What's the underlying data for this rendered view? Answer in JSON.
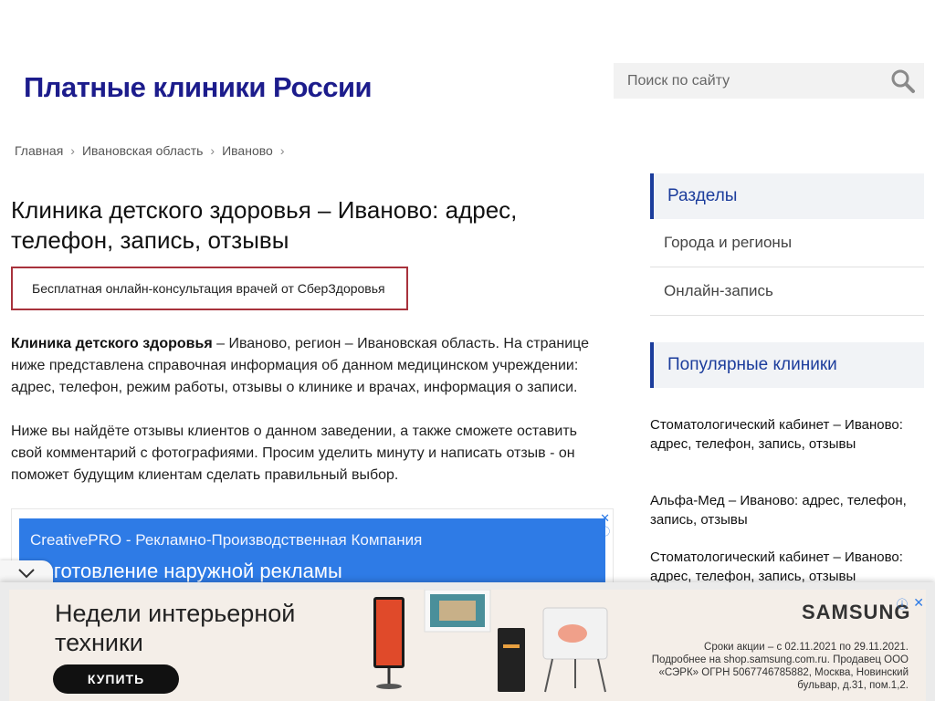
{
  "header": {
    "site_title": "Платные клиники России",
    "search_placeholder": "Поиск по сайту"
  },
  "breadcrumb": {
    "items": [
      "Главная",
      "Ивановская область",
      "Иваново"
    ],
    "separator": "›"
  },
  "main": {
    "title": "Клиника детского здоровья – Иваново: адрес, телефон, запись, отзывы",
    "consult_label": "Бесплатная онлайн-консультация врачей от СберЗдоровья",
    "para1_bold": "Клиника детского здоровья",
    "para1_rest": " – Иваново, регион – Ивановская область. На странице ниже представлена справочная информация об данном медицинском учреждении: адрес, телефон, режим работы, отзывы о клинике и врачах, информация о записи.",
    "para2": "Ниже вы найдёте отзывы клиентов о данном заведении, а также сможете оставить свой комментарий с фотографиями. Просим уделить минуту и написать отзыв - он поможет будущим клиентам сделать правильный выбор."
  },
  "ad_inline": {
    "line1": "CreativePRO - Рекламно-Производственная Компания",
    "line2": "Изготовление наружной рекламы",
    "close": "✕",
    "info": "ⓘ"
  },
  "sidebar": {
    "sections_title": "Разделы",
    "links": [
      "Города и регионы",
      "Онлайн-запись"
    ],
    "popular_title": "Популярные клиники",
    "popular": [
      "Стоматологический кабинет – Иваново: адрес, телефон, запись, отзывы",
      "Альфа-Мед – Иваново: адрес, телефон, запись, отзывы",
      "Стоматологический кабинет – Иваново: адрес, телефон, запись, отзывы"
    ]
  },
  "bottom_ad": {
    "headline": "Недели интерьерной техники",
    "buy_label": "КУПИТЬ",
    "brand": "SAMSUNG",
    "legal": "Сроки акции – с 02.11.2021 по 29.11.2021. Подробнее на shop.samsung.com.ru. Продавец ООО «СЭРК» ОГРН 5067746785882, Москва, Новинский бульвар, д.31, пом.1,2.",
    "close": "✕",
    "info": "ⓘ"
  },
  "colors": {
    "brand_title": "#1c1c8c",
    "accent_blue": "#1c3d9c",
    "consult_border": "#a8323c",
    "ad_blue": "#2e7be6"
  }
}
